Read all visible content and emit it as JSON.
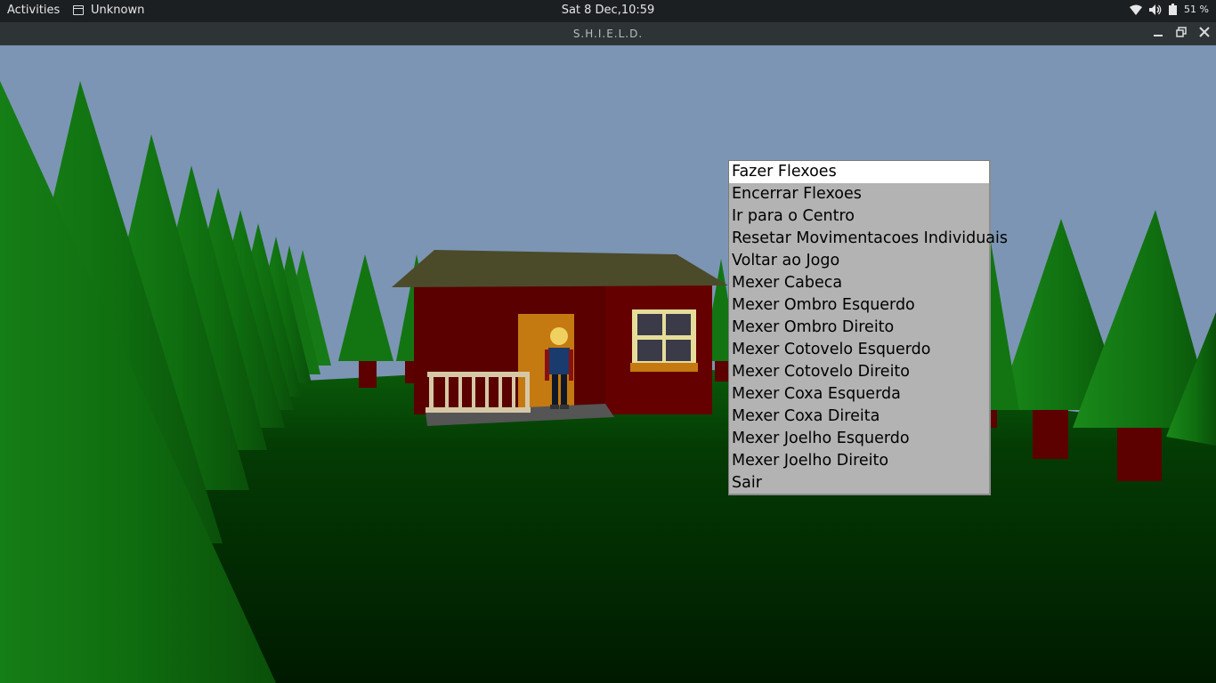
{
  "topbar": {
    "activities": "Activities",
    "app_name": "Unknown",
    "clock": "Sat 8 Dec,10:59",
    "battery": "51 %"
  },
  "window": {
    "title": "S.H.I.E.L.D.",
    "minimize": "minimize-icon",
    "maximize": "maximize-icon",
    "close": "close-icon"
  },
  "menu": {
    "items": [
      "Fazer Flexoes",
      "Encerrar Flexoes",
      "Ir para o Centro",
      "Resetar Movimentacoes Individuais",
      "Voltar ao Jogo",
      "Mexer Cabeca",
      "Mexer Ombro Esquerdo",
      "Mexer Ombro Direito",
      "Mexer Cotovelo Esquerdo",
      "Mexer Cotovelo Direito",
      "Mexer Coxa Esquerda",
      "Mexer Coxa Direita",
      "Mexer Joelho Esquerdo",
      "Mexer Joelho Direito",
      "Sair"
    ],
    "active_index": 0
  },
  "colors": {
    "sky": "#7c95b4",
    "ground": "#003000",
    "tree": "#0d6b0d",
    "trunk": "#5c0000",
    "house": "#5a0000",
    "roof": "#4b4b2a",
    "door": "#c47a10",
    "menu_bg": "#b3b3b3",
    "menu_active": "#ffffff"
  }
}
